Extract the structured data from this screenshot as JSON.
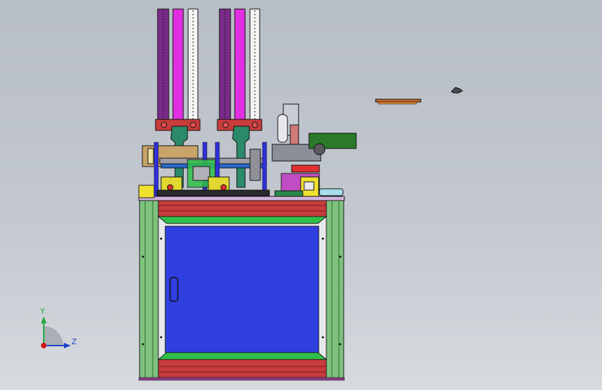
{
  "viewport": {
    "background_top": "#b8bec6",
    "background_bottom": "#d7dadf"
  },
  "triad": {
    "y_label": "Y",
    "z_label": "Z",
    "y_color": "#1fa83a",
    "z_color": "#1f43c8",
    "origin_color": "#d01818"
  },
  "colors": {
    "cabinet_green": "#7ec27e",
    "cabinet_red": "#c83c3c",
    "panel_blue": "#2f3fe0",
    "column_magenta": "#e02ee0",
    "column_purple": "#7a2a8a",
    "bracket_teal": "#2a8a6a",
    "outline": "#1a1a1a"
  }
}
